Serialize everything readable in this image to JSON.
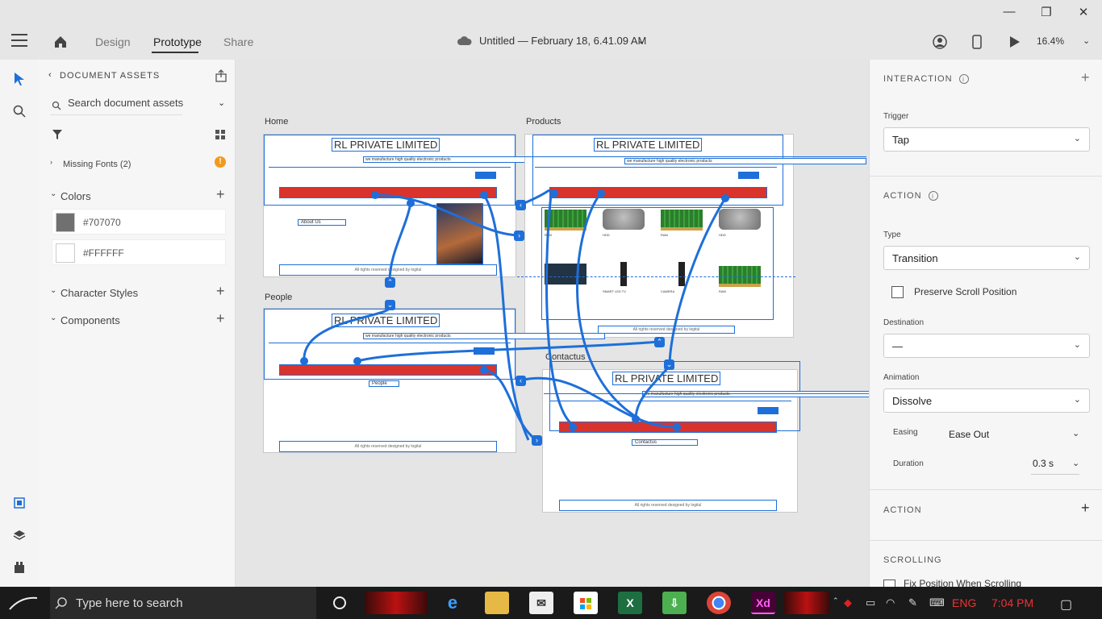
{
  "topbar": {
    "tabs": [
      "Design",
      "Prototype",
      "Share"
    ],
    "active_tab": "Prototype",
    "doc_title": "Untitled — February 18, 6.41.09 AM",
    "zoom": "16.4%",
    "window_controls": [
      "minimize-icon",
      "restore-icon",
      "close-icon"
    ]
  },
  "assets_panel": {
    "header": "DOCUMENT ASSETS",
    "search_placeholder": "Search document assets",
    "missing_fonts": "Missing Fonts (2)",
    "colors_title": "Colors",
    "colors": [
      {
        "label": "#707070",
        "hex": "#707070"
      },
      {
        "label": "#FFFFFF",
        "hex": "#FFFFFF"
      }
    ],
    "character_styles": "Character Styles",
    "components": "Components"
  },
  "canvas": {
    "artboards": [
      {
        "label": "Home",
        "title": "RL PRIVATE LIMITED",
        "tagline": "we manufacture high quality electronic products",
        "page_label": "About Us",
        "footer": "All rights reserved designed by logitul"
      },
      {
        "label": "Products",
        "title": "RL PRIVATE LIMITED",
        "tagline": "we manufacture high quality electronic products",
        "footer": "All rights reserved designed by logitul"
      },
      {
        "label": "People",
        "title": "RL PRIVATE LIMITED",
        "tagline": "we manufacture high quality electronic products",
        "page_label": "People",
        "footer": "All rights reserved designed by logitul"
      },
      {
        "label": "Contactus",
        "title": "RL PRIVATE LIMITED",
        "tagline": "we manufacture high quality electronic products",
        "page_label": "Contactus",
        "footer": "All rights reserved designed by logitul"
      }
    ],
    "products": [
      "RAM",
      "HDD",
      "RAM",
      "HDD",
      "",
      "SMART LED TV",
      "CAMERA",
      "RAM"
    ]
  },
  "interaction_panel": {
    "title": "INTERACTION",
    "trigger_label": "Trigger",
    "trigger_value": "Tap",
    "action_title": "ACTION",
    "type_label": "Type",
    "type_value": "Transition",
    "preserve_scroll": "Preserve Scroll Position",
    "destination_label": "Destination",
    "destination_value": "—",
    "animation_label": "Animation",
    "animation_value": "Dissolve",
    "easing_label": "Easing",
    "easing_value": "Ease Out",
    "duration_label": "Duration",
    "duration_value": "0.3 s",
    "action2_title": "ACTION",
    "scrolling_title": "SCROLLING",
    "fix_position": "Fix Position When Scrolling"
  },
  "taskbar": {
    "search_placeholder": "Type here to search",
    "lang": "ENG",
    "time": "7:04 PM",
    "xd_label": "Xd",
    "excel_label": "X"
  }
}
